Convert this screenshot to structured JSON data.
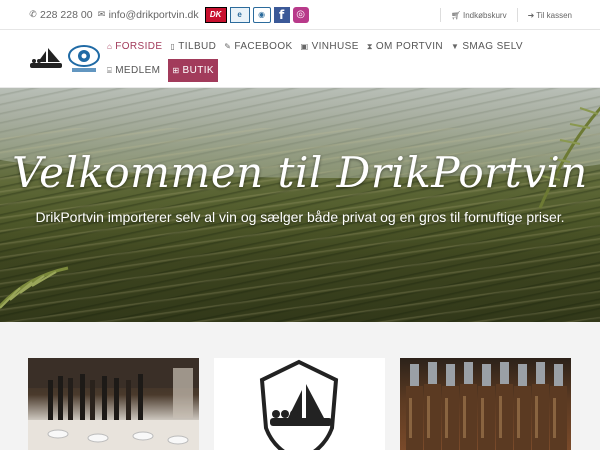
{
  "topbar": {
    "phone": "228 228 00",
    "email": "info@drikportvin.dk",
    "badges": {
      "dk": "DK",
      "emk1": "e",
      "emk2": "◉",
      "facebook": "f",
      "instagram": "◎"
    },
    "cart_label": "Indkøbskurv",
    "checkout_label": "Til kassen"
  },
  "nav": {
    "items": [
      {
        "label": "FORSIDE",
        "icon": "home-icon"
      },
      {
        "label": "TILBUD",
        "icon": "bookmark-icon"
      },
      {
        "label": "FACEBOOK",
        "icon": "pencil-icon"
      },
      {
        "label": "VINHUSE",
        "icon": "image-icon"
      },
      {
        "label": "OM PORTVIN",
        "icon": "hourglass-icon"
      },
      {
        "label": "SMAG SELV",
        "icon": "glass-icon"
      },
      {
        "label": "MEDLEM",
        "icon": "bank-icon"
      },
      {
        "label": "BUTIK",
        "icon": "basket-icon"
      }
    ]
  },
  "hero": {
    "title": "Velkommen til DrikPortvin",
    "subtitle": "DrikPortvin importerer selv al vin og sælger både privat og en gros til fornuftige priser."
  },
  "colors": {
    "accent": "#a23b5b",
    "topbar_bg": "#ffffff",
    "page_bg": "#f3f3f3"
  }
}
